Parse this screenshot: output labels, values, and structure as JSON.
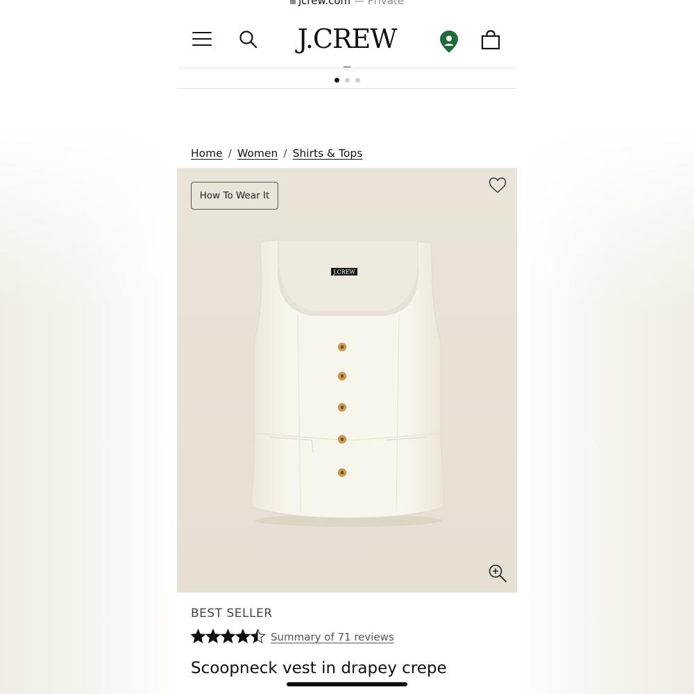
{
  "browser": {
    "domain": "jcrew.com",
    "separator": "—",
    "mode": "Private"
  },
  "header": {
    "logo": "J.CREW"
  },
  "promo": {
    "carousel_pages": 3,
    "active_page": 1
  },
  "breadcrumb": {
    "items": [
      "Home",
      "Women",
      "Shirts & Tops"
    ],
    "separator": "/"
  },
  "product": {
    "how_to_wear_label": "How To Wear It",
    "badge": "BEST SELLER",
    "rating": 4.5,
    "rating_max": 5,
    "reviews_link": "Summary of 71 reviews",
    "title": "Scoopneck vest in drapey crepe",
    "label_tag": "J.CREW",
    "image_bg_color": "#e8e3d6",
    "garment_color": "#f6f2e8"
  },
  "icons": {
    "menu": "hamburger-menu-icon",
    "search": "search-icon",
    "location": "location-pin-icon",
    "bag": "shopping-bag-icon",
    "favorite": "heart-icon",
    "zoom": "zoom-in-icon"
  },
  "colors": {
    "location_pin": "#1f6b3a",
    "text": "#111111"
  }
}
